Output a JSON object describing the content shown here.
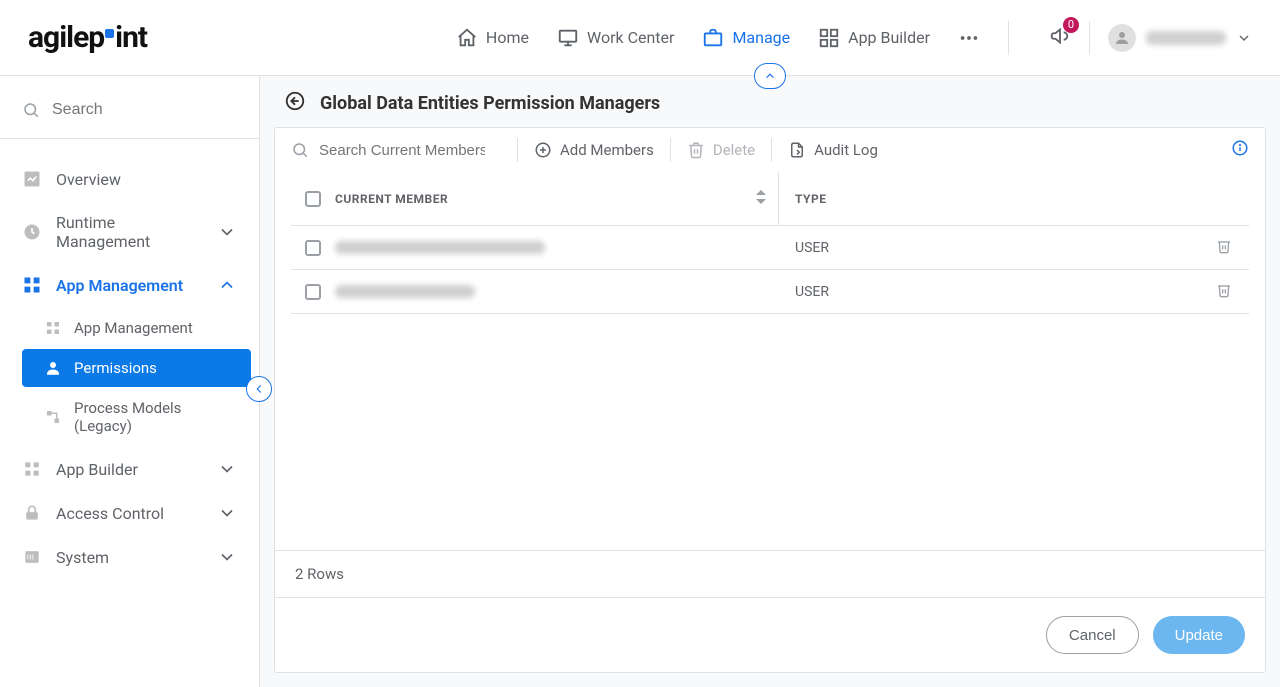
{
  "brand": {
    "name_left": "agilep",
    "name_right": "int"
  },
  "nav": {
    "home": "Home",
    "work_center": "Work Center",
    "manage": "Manage",
    "app_builder": "App Builder"
  },
  "notifications_count": "0",
  "sidebar": {
    "search_placeholder": "Search",
    "overview": "Overview",
    "runtime": "Runtime Management",
    "app_mgmt": "App Management",
    "sub": {
      "app_mgmt": "App Management",
      "permissions": "Permissions",
      "process_models": "Process Models (Legacy)"
    },
    "app_builder": "App Builder",
    "access_control": "Access Control",
    "system": "System"
  },
  "page": {
    "title": "Global Data Entities Permission Managers"
  },
  "toolbar": {
    "search_placeholder": "Search Current Members",
    "add_members": "Add Members",
    "delete": "Delete",
    "audit_log": "Audit Log"
  },
  "columns": {
    "member": "CURRENT MEMBER",
    "type": "TYPE"
  },
  "rows": [
    {
      "type": "USER"
    },
    {
      "type": "USER"
    }
  ],
  "rows_count_label": "2 Rows",
  "footer": {
    "cancel": "Cancel",
    "update": "Update"
  }
}
